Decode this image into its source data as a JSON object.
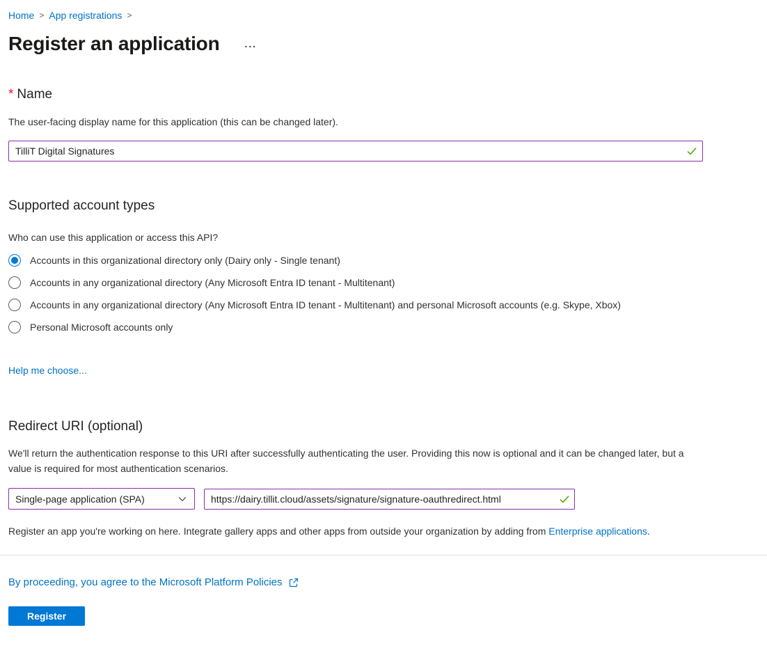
{
  "breadcrumb": {
    "separator": ">",
    "items": [
      {
        "label": "Home"
      },
      {
        "label": "App registrations"
      }
    ]
  },
  "header": {
    "title": "Register an application",
    "context_menu_ellipsis": "..."
  },
  "name_section": {
    "required_marker": "*",
    "label": "Name",
    "description": "The user-facing display name for this application (this can be changed later).",
    "value": "TilliT Digital Signatures",
    "validation_icon": "green-checkmark"
  },
  "account_types": {
    "heading": "Supported account types",
    "question": "Who can use this application or access this API?",
    "options": [
      {
        "label": "Accounts in this organizational directory only (Dairy only - Single tenant)",
        "selected": true
      },
      {
        "label": "Accounts in any organizational directory (Any Microsoft Entra ID tenant - Multitenant)",
        "selected": false
      },
      {
        "label": "Accounts in any organizational directory (Any Microsoft Entra ID tenant - Multitenant) and personal Microsoft accounts (e.g. Skype, Xbox)",
        "selected": false
      },
      {
        "label": "Personal Microsoft accounts only",
        "selected": false
      }
    ],
    "help_link": "Help me choose..."
  },
  "redirect_section": {
    "heading": "Redirect URI (optional)",
    "description": "We'll return the authentication response to this URI after successfully authenticating the user. Providing this now is optional and it can be changed later, but a value is required for most authentication scenarios.",
    "platform_selected": "Single-page application (SPA)",
    "uri_value": "https://dairy.tillit.cloud/assets/signature/signature-oauthredirect.html",
    "validation_icon": "green-checkmark",
    "note_prefix": "Register an app you're working on here. Integrate gallery apps and other apps from outside your organization by adding from ",
    "note_link": "Enterprise applications",
    "note_suffix": "."
  },
  "footer": {
    "policy_link": "By proceeding, you agree to the Microsoft Platform Policies",
    "register_button": "Register"
  },
  "colors": {
    "link_blue": "#0072c9",
    "accent_blue": "#0078d4",
    "dirty_field_purple": "#8a2da5",
    "valid_green": "#57a300",
    "required_red": "#e81123",
    "text_primary": "#323130",
    "divider_gray": "#e1dfdd"
  }
}
